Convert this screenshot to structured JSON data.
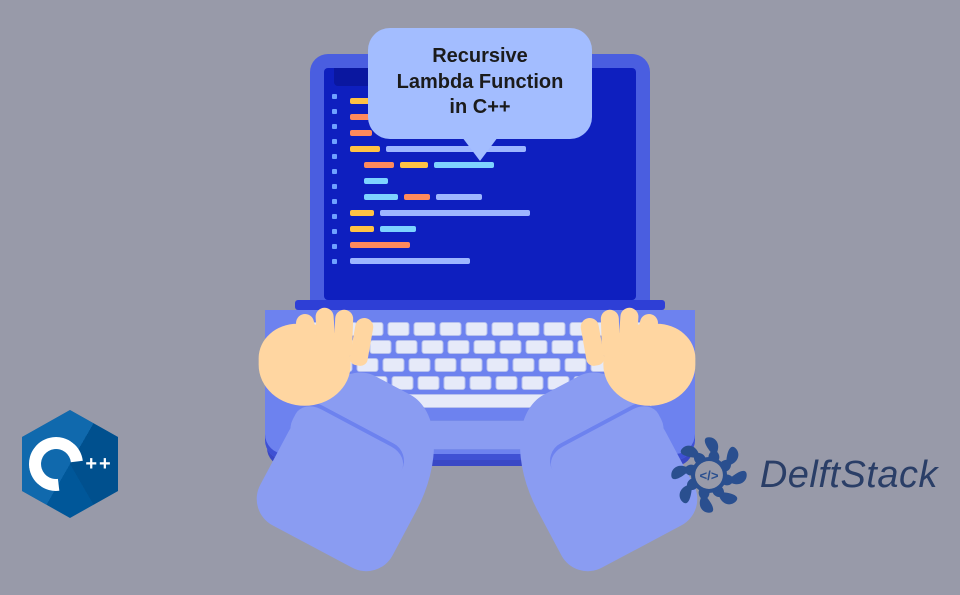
{
  "bubble": {
    "line1": "Recursive",
    "line2": "Lambda Function",
    "line3": "in C++"
  },
  "cpp": {
    "letter": "C",
    "plus1": "+",
    "plus2": "+"
  },
  "brand": {
    "name": "DelftStack",
    "icon_inner": "</>"
  }
}
